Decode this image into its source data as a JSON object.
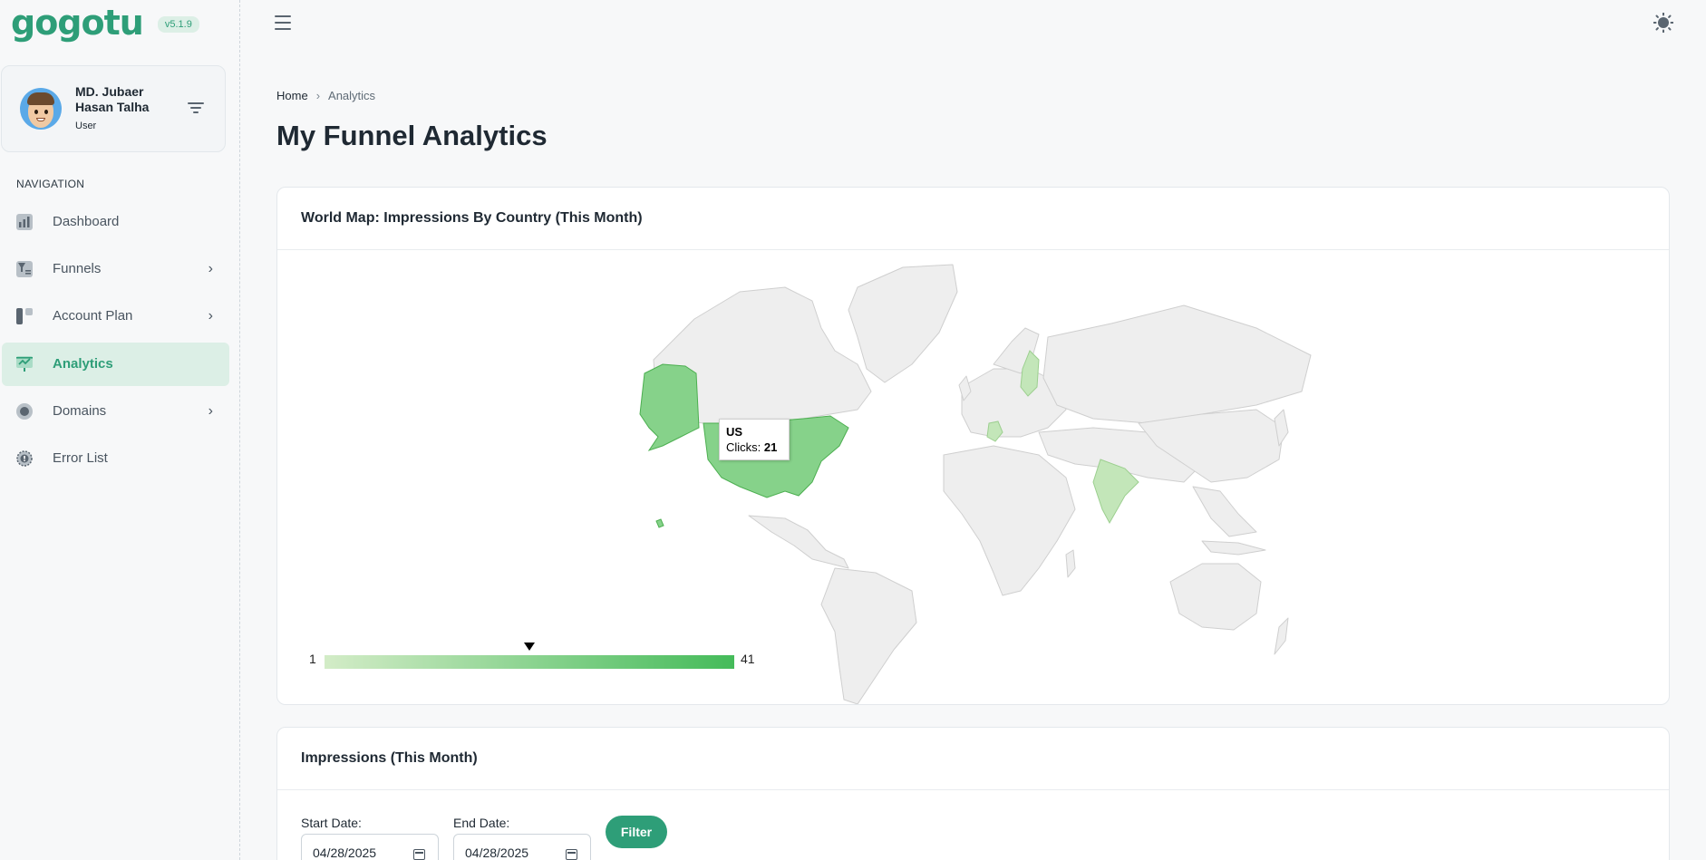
{
  "app": {
    "logo": "gogotu",
    "version": "v5.1.9"
  },
  "user": {
    "name": "MD. Jubaer Hasan Talha",
    "role": "User"
  },
  "sidebar": {
    "heading": "NAVIGATION",
    "items": [
      {
        "label": "Dashboard",
        "icon": "dashboard-icon",
        "has_submenu": false,
        "active": false
      },
      {
        "label": "Funnels",
        "icon": "funnel-icon",
        "has_submenu": true,
        "active": false
      },
      {
        "label": "Account Plan",
        "icon": "account-plan-icon",
        "has_submenu": true,
        "active": false
      },
      {
        "label": "Analytics",
        "icon": "analytics-icon",
        "has_submenu": false,
        "active": true
      },
      {
        "label": "Domains",
        "icon": "domain-icon",
        "has_submenu": true,
        "active": false
      },
      {
        "label": "Error List",
        "icon": "error-list-icon",
        "has_submenu": false,
        "active": false
      }
    ]
  },
  "breadcrumb": {
    "home": "Home",
    "current": "Analytics"
  },
  "page": {
    "title": "My Funnel Analytics"
  },
  "map_card": {
    "title": "World Map: Impressions By Country (This Month)",
    "legend_min": "1",
    "legend_max": "41",
    "marker_value": 21,
    "tooltip": {
      "country": "US",
      "label": "Clicks:",
      "value": "21"
    },
    "highlighted_countries": [
      {
        "country": "US",
        "clicks": 21
      },
      {
        "country": "Finland"
      },
      {
        "country": "Germany"
      },
      {
        "country": "India"
      }
    ],
    "colors": {
      "low": "#d3ecc7",
      "high": "#45bb5a",
      "land": "#eeeeee",
      "border": "#cfcfcf"
    }
  },
  "impressions_card": {
    "title": "Impressions (This Month)",
    "start_label": "Start Date:",
    "start_value": "04/28/2025",
    "end_label": "End Date:",
    "end_value": "04/28/2025",
    "filter_label": "Filter"
  },
  "colors": {
    "accent": "#2e9e78",
    "accent_light": "#dcefe6"
  }
}
